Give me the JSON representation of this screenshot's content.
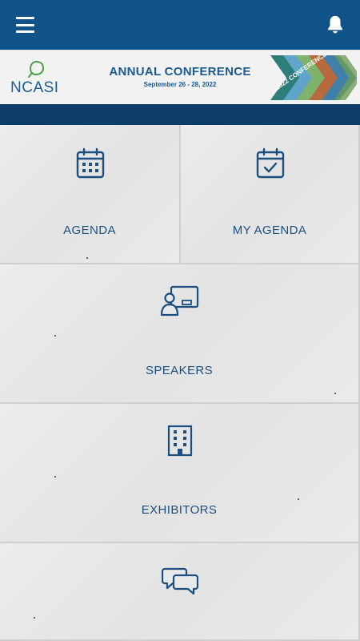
{
  "header": {
    "menu_icon": "hamburger-menu-icon",
    "notification_icon": "bell-icon",
    "bar_color": "#0f5389"
  },
  "banner": {
    "logo_text": "NCASI",
    "title": "ANNUAL CONFERENCE",
    "dates": "September 26 - 28, 2022",
    "graphic_text": "2022 CONFERENCE"
  },
  "tiles": [
    {
      "label": "AGENDA",
      "icon": "calendar-icon"
    },
    {
      "label": "MY AGENDA",
      "icon": "calendar-check-icon"
    },
    {
      "label": "SPEAKERS",
      "icon": "presenter-board-icon"
    },
    {
      "label": "EXHIBITORS",
      "icon": "building-icon"
    },
    {
      "label": "",
      "icon": "chat-bubbles-icon"
    }
  ],
  "colors": {
    "primary": "#0f5389",
    "dark_band": "#0c3d66",
    "tile_text": "#1b4f80",
    "tile_bg": "#e8e8e8"
  }
}
